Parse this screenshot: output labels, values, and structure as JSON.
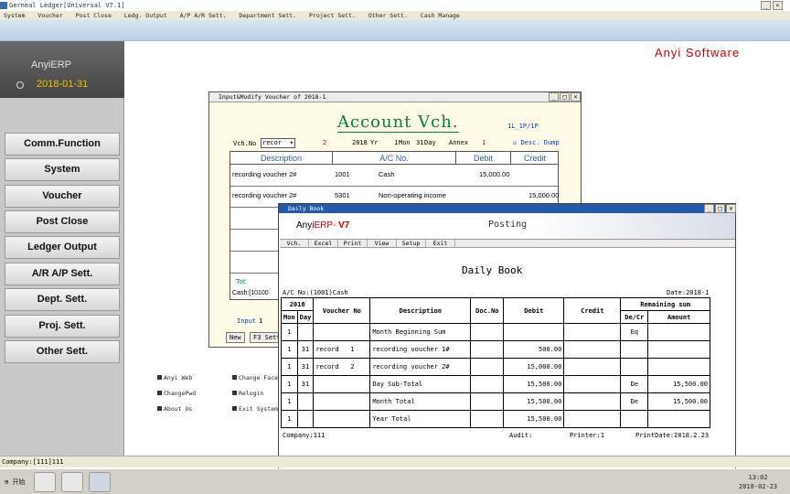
{
  "window": {
    "title": "Gerneal Ledger[Universal V7.1]"
  },
  "menu": [
    "System",
    "Voucher",
    "Post Close",
    "Ledg. Output",
    "A/P A/R Sett.",
    "Department Sett.",
    "Project Sett.",
    "Other Sett.",
    "Cash Manage"
  ],
  "logo": {
    "brand": "AnyiERP",
    "date": "2018-01-31"
  },
  "brand_right": "Anyi Software",
  "nav": [
    "Comm.Function",
    "System",
    "Voucher",
    "Post Close",
    "Ledger Output",
    "A/R A/P Sett.",
    "Dept. Sett.",
    "Proj. Sett.",
    "Other Sett."
  ],
  "links": [
    "Anyi Web",
    "Change Face",
    "ChangePwd",
    "Relogin",
    "About Us",
    "Exit System"
  ],
  "status": "Company:[111]111",
  "taskbar": {
    "start": "开始",
    "time": "13:02",
    "date": "2018-02-23"
  },
  "voucher": {
    "title": "Input&Modify Voucher of 2018-1",
    "heading": "Account Vch.",
    "page": "1L_1P/1P",
    "vch_no_label": "Vch.No",
    "vch_type": "recor",
    "vch_no": "2",
    "year": "2018",
    "yr_label": "Yr",
    "month": "1",
    "mon_label": "Mon",
    "day": "31",
    "day_label": "Day",
    "annex_label": "Annex",
    "annex": "1",
    "desc_dump": "Desc. Dump",
    "headers": [
      "Description",
      "A/C No.",
      "Debit",
      "Credit"
    ],
    "rows": [
      {
        "desc": "recording voucher 2#",
        "acno": "1001",
        "acname": "Cash",
        "debit": "15,000.00",
        "credit": ""
      },
      {
        "desc": "recording voucher 2#",
        "acno": "5301",
        "acname": "Non-operating income",
        "debit": "",
        "credit": "15,000.00"
      }
    ],
    "tot": "Tot:",
    "cash": "Cash:[10100",
    "input_label": "Input",
    "input_val": "1",
    "btn_new": "New",
    "btn_f3": "F3 Sett"
  },
  "daily": {
    "wtitle": "Daily Book",
    "brand1": "Anyi",
    "brand2": "ERP-",
    "brand3": "V7",
    "posting": "Posting",
    "toolbar": [
      "Vch.",
      "Excel",
      "Print",
      "View",
      "Setup",
      "Exit"
    ],
    "title": "Daily Book",
    "ac": "A/C No:(1001)Cash",
    "date": "Date:2018-1",
    "h_year": "2018",
    "h_mon": "Mon",
    "h_day": "Day",
    "h_voucher": "Voucher No",
    "h_desc": "Description",
    "h_docno": "Doc.No",
    "h_debit": "Debit",
    "h_credit": "Credit",
    "h_remain": "Remaining sum",
    "h_decr": "De/Cr",
    "h_amount": "Amount",
    "rows": [
      {
        "mon": "1",
        "day": "",
        "vtype": "",
        "vno": "",
        "desc": "Month Beginning Sum",
        "doc": "",
        "debit": "",
        "credit": "",
        "dc": "Eq",
        "amount": ""
      },
      {
        "mon": "1",
        "day": "31",
        "vtype": "record",
        "vno": "1",
        "desc": "recording voucher 1#",
        "doc": "",
        "debit": "500.00",
        "credit": "",
        "dc": "",
        "amount": ""
      },
      {
        "mon": "1",
        "day": "31",
        "vtype": "record",
        "vno": "2",
        "desc": "recording voucher 2#",
        "doc": "",
        "debit": "15,000.00",
        "credit": "",
        "dc": "",
        "amount": ""
      },
      {
        "mon": "1",
        "day": "31",
        "vtype": "",
        "vno": "",
        "desc": "Day Sub-Total",
        "doc": "",
        "debit": "15,500.00",
        "credit": "",
        "dc": "De",
        "amount": "15,500.00"
      },
      {
        "mon": "1",
        "day": "",
        "vtype": "",
        "vno": "",
        "desc": "Month Total",
        "doc": "",
        "debit": "15,500.00",
        "credit": "",
        "dc": "De",
        "amount": "15,500.00"
      },
      {
        "mon": "1",
        "day": "",
        "vtype": "",
        "vno": "",
        "desc": "Year Total",
        "doc": "",
        "debit": "15,500.00",
        "credit": "",
        "dc": "",
        "amount": ""
      }
    ],
    "company": "Company:111",
    "audit": "Audit:",
    "printer": "Printer:1",
    "printdate": "PrintDate:2018.2.23"
  }
}
